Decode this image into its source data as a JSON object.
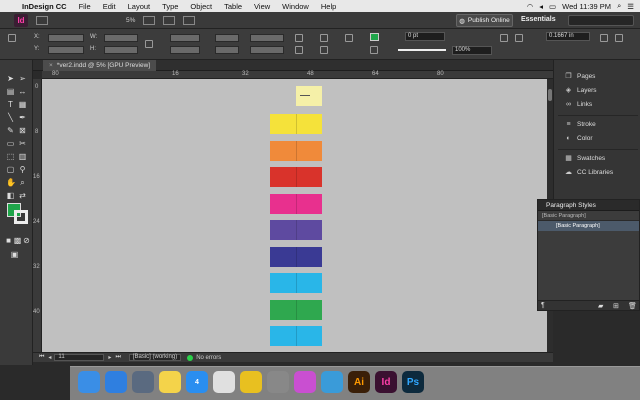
{
  "menubar": {
    "app_name": "InDesign CC",
    "items": [
      "File",
      "Edit",
      "Layout",
      "Type",
      "Object",
      "Table",
      "View",
      "Window",
      "Help"
    ],
    "clock": "Wed 11:39 PM"
  },
  "appbar": {
    "logo": "Id",
    "zoom": "5%",
    "publish_label": "Publish Online",
    "workspace": "Essentials"
  },
  "control": {
    "x_label": "X:",
    "y_label": "Y:",
    "w_label": "W:",
    "h_label": "H:",
    "stroke_weight": "0 pt",
    "opacity": "100%",
    "ref_value": "0.1667 in",
    "fill_color": "#1fa54a"
  },
  "document": {
    "tab_title": "*ver2.indd @ 5% [GPU Preview]",
    "h_ruler": [
      "80",
      "16",
      "32",
      "48",
      "64",
      "80"
    ],
    "v_ruler": [
      "0",
      "8",
      "16",
      "24",
      "32",
      "40"
    ],
    "spreads": [
      {
        "color": "#f5e23a"
      },
      {
        "color": "#f08a3a"
      },
      {
        "color": "#d9332b"
      },
      {
        "color": "#e8308e"
      },
      {
        "color": "#5e4aa0"
      },
      {
        "color": "#3a3a94"
      },
      {
        "color": "#29b6e8"
      },
      {
        "color": "#2fa84f"
      },
      {
        "color": "#29b6e8"
      }
    ],
    "cover_color": "#f5f0a8"
  },
  "statusbar": {
    "page": "11",
    "style": "[Basic] (working)",
    "errors": "No errors"
  },
  "panels": {
    "items": [
      {
        "label": "Pages",
        "icon": "pages-icon"
      },
      {
        "label": "Layers",
        "icon": "layers-icon"
      },
      {
        "label": "Links",
        "icon": "links-icon"
      },
      {
        "label": "Stroke",
        "icon": "stroke-icon"
      },
      {
        "label": "Color",
        "icon": "color-icon"
      },
      {
        "label": "Swatches",
        "icon": "swatches-icon"
      },
      {
        "label": "CC Libraries",
        "icon": "cc-libraries-icon"
      }
    ]
  },
  "paragraph_styles": {
    "title": "Paragraph Styles",
    "current": "[Basic Paragraph]",
    "selected_row": "[Basic Paragraph]"
  },
  "dock": {
    "apps": [
      {
        "name": "Finder",
        "label": "",
        "color": "#3a8ee6"
      },
      {
        "name": "Safari",
        "label": "",
        "color": "#2f7fe0"
      },
      {
        "name": "Launchpad",
        "label": "",
        "color": "#5a6a80"
      },
      {
        "name": "Notes",
        "label": "",
        "color": "#f4d34a"
      },
      {
        "name": "App Store",
        "label": "4",
        "color": "#2a8ef0"
      },
      {
        "name": "Chrome",
        "label": "",
        "color": "#e0e0e0"
      },
      {
        "name": "Notes2",
        "label": "",
        "color": "#e8c020"
      },
      {
        "name": "System Preferences",
        "label": "",
        "color": "#888"
      },
      {
        "name": "iTunes",
        "label": "",
        "color": "#c94fd1"
      },
      {
        "name": "Screenshot",
        "label": "",
        "color": "#3a9bd9"
      },
      {
        "name": "Illustrator",
        "label": "Ai",
        "color": "#3a1f08"
      },
      {
        "name": "InDesign",
        "label": "Id",
        "color": "#3a1030"
      },
      {
        "name": "Photoshop",
        "label": "Ps",
        "color": "#0d2a3d"
      }
    ]
  }
}
